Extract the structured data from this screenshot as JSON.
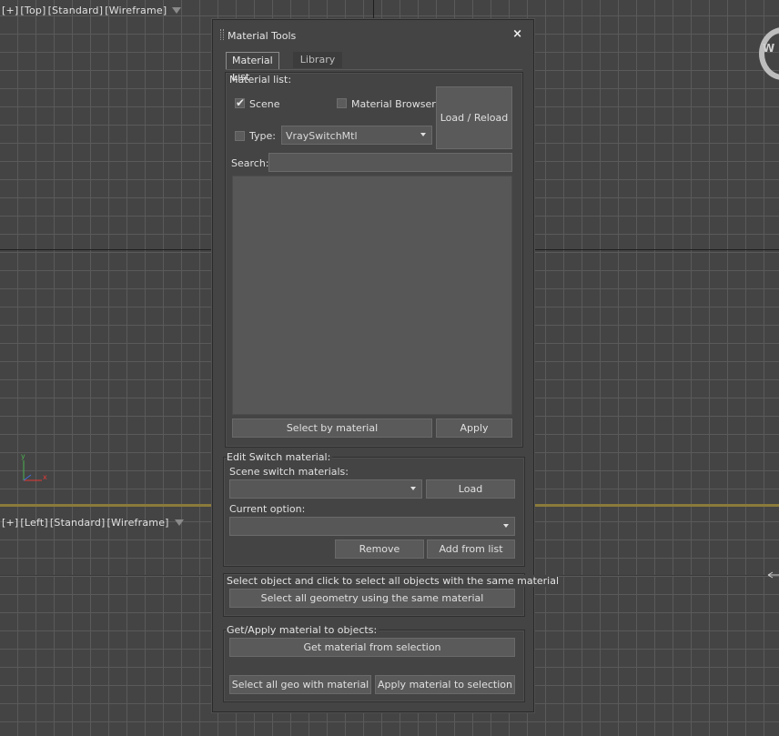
{
  "viewport_top": {
    "label_parts": [
      "[+]",
      "[Top]",
      "[Standard]",
      "[Wireframe]"
    ]
  },
  "viewport_left": {
    "label_parts": [
      "[+]",
      "[Left]",
      "[Standard]",
      "[Wireframe]"
    ]
  },
  "compass_letter": "W",
  "gizmo": {
    "x_label": "x",
    "y_label": "y"
  },
  "panel": {
    "title": "Material Tools",
    "close_glyph": "×",
    "tabs": [
      "Material List",
      "Library"
    ],
    "material_list": {
      "group_label": "Material list:",
      "scene_label": "Scene",
      "scene_checked": true,
      "browser_label": "Material Browser",
      "browser_checked": false,
      "load_reload_label": "Load / Reload",
      "type_label": "Type:",
      "type_checked": false,
      "type_value": "VraySwitchMtl",
      "search_label": "Search:",
      "search_value": "",
      "select_by_material_label": "Select by material",
      "apply_label": "Apply"
    },
    "edit_switch": {
      "group_label": "Edit Switch material:",
      "scene_switch_label": "Scene switch materials:",
      "scene_switch_value": "",
      "load_label": "Load",
      "current_option_label": "Current option:",
      "current_option_value": "",
      "remove_label": "Remove",
      "add_from_list_label": "Add from list"
    },
    "select_same": {
      "group_label": "Select object and click to select all objects with the same material",
      "button_label": "Select all geometry using the same material"
    },
    "get_apply": {
      "group_label": "Get/Apply material to objects:",
      "get_label": "Get material from selection",
      "select_all_geo_label": "Select all geo with material",
      "apply_to_selection_label": "Apply material to selection"
    }
  },
  "colors": {
    "viewport_bg": "#444444",
    "grid_line": "#5a5a5a",
    "viewport_separator": "#8b7a3a",
    "panel_bg": "#444444",
    "button_bg": "#5a5a5a"
  }
}
